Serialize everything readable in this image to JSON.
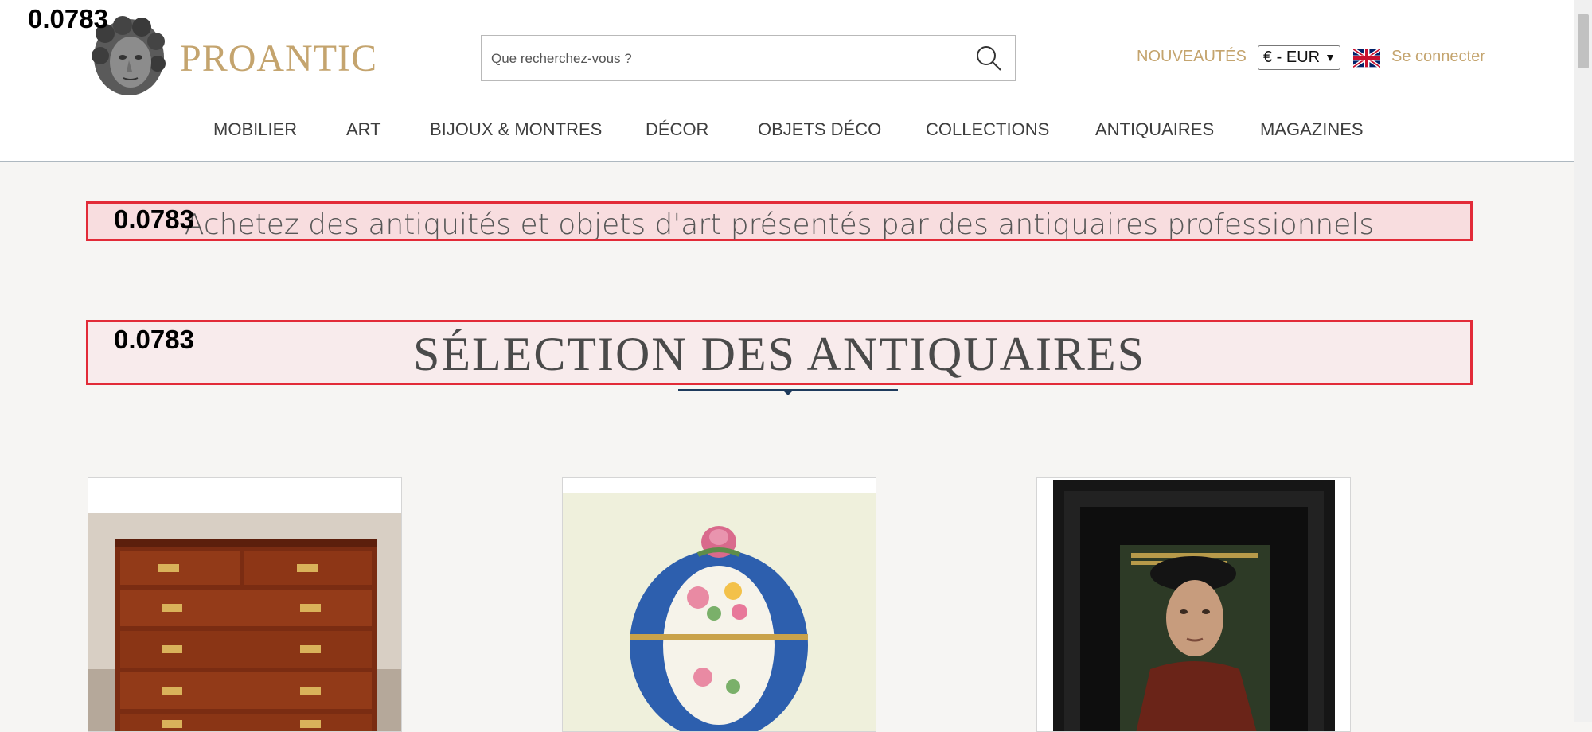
{
  "score_badge": "0.0783",
  "header": {
    "brand": "PROANTIC",
    "search_placeholder": "Que recherchez-vous ?",
    "new_link": "NOUVEAUTÉS",
    "currency": "€ - EUR",
    "login": "Se connecter",
    "icons": {
      "search": "search-icon",
      "flag": "uk-flag-icon",
      "logo": "logo-head-icon"
    }
  },
  "nav": {
    "items": [
      "MOBILIER",
      "ART",
      "BIJOUX & MONTRES",
      "DÉCOR",
      "OBJETS DÉCO",
      "COLLECTIONS",
      "ANTIQUAIRES",
      "MAGAZINES"
    ]
  },
  "tagline": {
    "score": "0.0783",
    "text": "Achetez des antiquités et objets d'art présentés par des antiquaires professionnels"
  },
  "selection": {
    "score": "0.0783",
    "heading": "SÉLECTION DES ANTIQUAIRES"
  },
  "cards": [
    {
      "image": "chest-of-drawers-image"
    },
    {
      "image": "porcelain-bonbonniere-image"
    },
    {
      "image": "framed-portrait-painting-image"
    }
  ],
  "colors": {
    "brand_gold": "#c4a46e",
    "highlight_border": "#e22b38",
    "divider": "#1d3a5c"
  }
}
